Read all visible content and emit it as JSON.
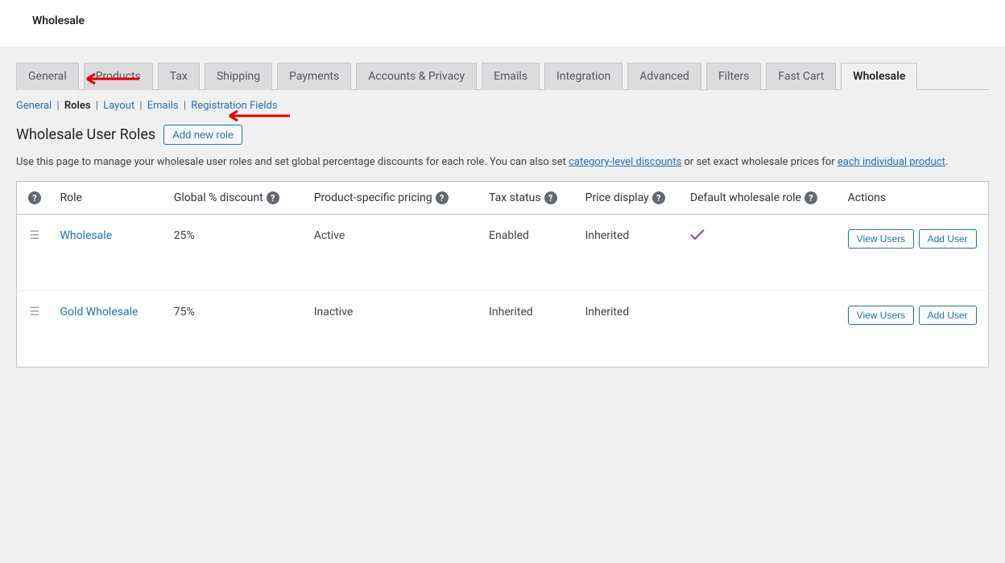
{
  "header": {
    "title": "Wholesale"
  },
  "tabs": [
    "General",
    "Products",
    "Tax",
    "Shipping",
    "Payments",
    "Accounts & Privacy",
    "Emails",
    "Integration",
    "Advanced",
    "Filters",
    "Fast Cart",
    "Wholesale"
  ],
  "active_tab": "Wholesale",
  "subtabs": {
    "items": [
      "General",
      "Roles",
      "Layout",
      "Emails",
      "Registration Fields"
    ],
    "active": "Roles"
  },
  "page_title": "Wholesale User Roles",
  "add_button": "Add new role",
  "description_parts": {
    "pre": "Use this page to manage your wholesale user roles and set global percentage discounts for each role. You can also set ",
    "link1": "category-level discounts",
    "mid": " or set exact wholesale prices for ",
    "link2": "each individual product",
    "post": "."
  },
  "columns": {
    "role": "Role",
    "discount": "Global % discount",
    "pricing": "Product-specific pricing",
    "tax": "Tax status",
    "price": "Price display",
    "default": "Default wholesale role",
    "actions": "Actions"
  },
  "buttons": {
    "view_users": "View Users",
    "add_user": "Add User"
  },
  "rows": [
    {
      "role": "Wholesale",
      "discount": "25%",
      "pricing": "Active",
      "tax": "Enabled",
      "price": "Inherited",
      "default": true
    },
    {
      "role": "Gold Wholesale",
      "discount": "75%",
      "pricing": "Inactive",
      "tax": "Inherited",
      "price": "Inherited",
      "default": false
    }
  ]
}
